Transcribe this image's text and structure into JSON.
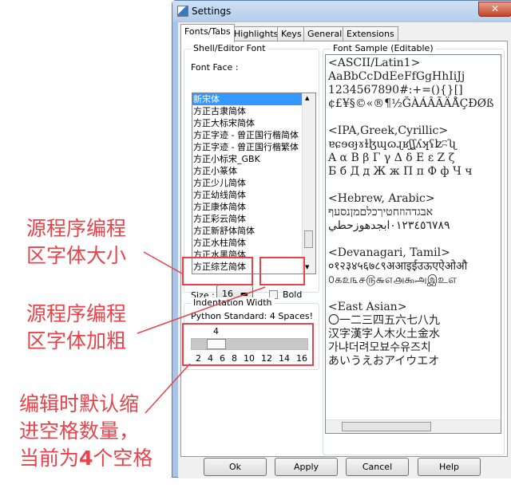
{
  "window": {
    "title": "Settings",
    "close_icon": "close-icon"
  },
  "tabs": [
    {
      "label": "Fonts/Tabs",
      "active": true
    },
    {
      "label": "Highlights"
    },
    {
      "label": "Keys"
    },
    {
      "label": "General"
    },
    {
      "label": "Extensions"
    }
  ],
  "font_frame": {
    "title": "Shell/Editor Font",
    "face_label": "Font Face :",
    "fonts": [
      "新宋体",
      "方正古隶简体",
      "方正大标宋简体",
      "方正字迹 - 曾正国行楷简体",
      "方正字迹 - 曾正国行楷繁体",
      "方正小标宋_GBK",
      "方正小篆体",
      "方正少儿简体",
      "方正幼线简体",
      "方正康体简体",
      "方正彩云简体",
      "方正新舒体简体",
      "方正水柱简体",
      "方正水黑简体",
      "方正综艺简体"
    ],
    "selected": "新宋体",
    "size_label": "Size :",
    "size_value": "16",
    "bold_label": "Bold",
    "bold_checked": false
  },
  "indent": {
    "title": "Indentation Width",
    "note": "Python Standard: 4 Spaces!",
    "value": "4",
    "ticks": [
      "2",
      "4",
      "6",
      "8",
      "10",
      "12",
      "14",
      "16"
    ]
  },
  "sample": {
    "title": "Font Sample (Editable)",
    "text": "<ASCII/Latin1>\nAaBbCcDdEeFfGgHhIiJj\n1234567890#:+=(){}[]\n¢£¥§©«®¶½ĞÀÁÂÃÄÅÇÐØß\n\n<IPA,Greek,Cyrillic>\nɐɕɘɞɟɤɫɮɰɷɻʁʃʆʎʞʢʫʭʯ\nΑ α Β β Γ γ Δ δ Ε ε Ζ ζ\nБ б Д д Ж ж П п Ф ф Ч ч\n\n<Hebrew, Arabic>\nאבגדהוזחטיךכלםמןנסעף\n٠١٢٣٤٥٦٧٨٩ابجدهوزحطي\n\n<Devanagari, Tamil>\n०१२३४५६७८९अआइईउऊएऐओऔ\n௦௧௨௩௪௫௬௭௮௯அஇஉஎ\n\n<East Asian>\n〇一二三四五六七八九\n汉字漢字人木火土金水\n가냐더려모뵤수유즈치\nあいうえおアイウエオ"
  },
  "buttons": {
    "ok": "Ok",
    "apply": "Apply",
    "cancel": "Cancel",
    "help": "Help"
  },
  "annotations": {
    "size": "源程序编程\n区字体大小",
    "bold": "源程序编程\n区字体加粗",
    "indent_a": "编辑时默认缩\n进空格数量，\n当前为",
    "indent_num": "4",
    "indent_b": "个空格"
  },
  "colors": {
    "annotation": "#e8434a",
    "selection": "#3399ff"
  }
}
